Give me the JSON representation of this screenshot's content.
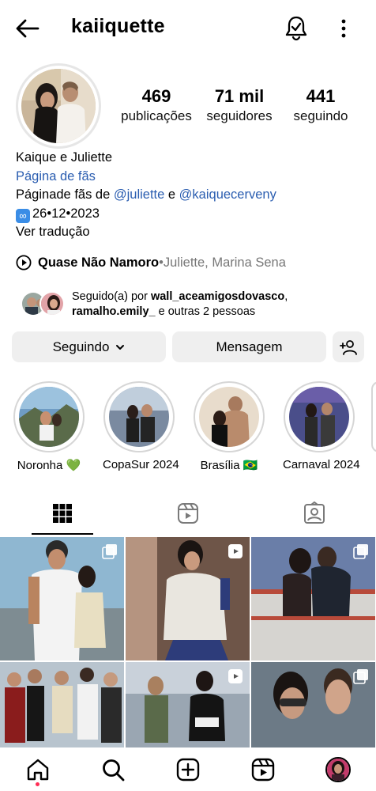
{
  "header": {
    "username": "kaiiquette"
  },
  "stats": {
    "posts": {
      "value": "469",
      "label": "publicações"
    },
    "followers": {
      "value": "71 mil",
      "label": "seguidores"
    },
    "following": {
      "value": "441",
      "label": "seguindo"
    }
  },
  "bio": {
    "name": "Kaique e Juliette",
    "category": "Página de fãs",
    "line_prefix": "Páginade fãs de ",
    "mention1": "@juliette",
    "line_mid": " e ",
    "mention2": "@kaiquecerveny",
    "date": "26•12•2023",
    "translate": "Ver tradução"
  },
  "music": {
    "song": "Quase Não Namoro",
    "separator": " • ",
    "artists": "Juliette, Marina Sena"
  },
  "followed_by": {
    "prefix": "Seguido(a) por ",
    "user1": "wall_aceamigosdovasco",
    "comma": ",",
    "user2": "ramalho.emily_",
    "suffix": " e outras 2 pessoas"
  },
  "actions": {
    "following": "Seguindo",
    "message": "Mensagem"
  },
  "highlights": [
    {
      "label": "Noronha 💚"
    },
    {
      "label": "CopaSur 2024"
    },
    {
      "label": "Brasília 🇧🇷"
    },
    {
      "label": "Carnaval 2024"
    }
  ],
  "icons": {
    "back": "arrow-left-icon",
    "bell": "notification-bell-icon",
    "more": "more-vertical-icon",
    "grid": "grid-icon",
    "reels": "reels-icon",
    "tagged": "tagged-icon",
    "home": "home-icon",
    "search": "search-icon",
    "create": "create-icon",
    "reels_nav": "reels-icon",
    "profile": "profile-avatar"
  },
  "colors": {
    "link": "#2a5db0",
    "button_bg": "#efefef",
    "notification_dot": "#ff2d55",
    "date_badge": "#3a8de6"
  }
}
